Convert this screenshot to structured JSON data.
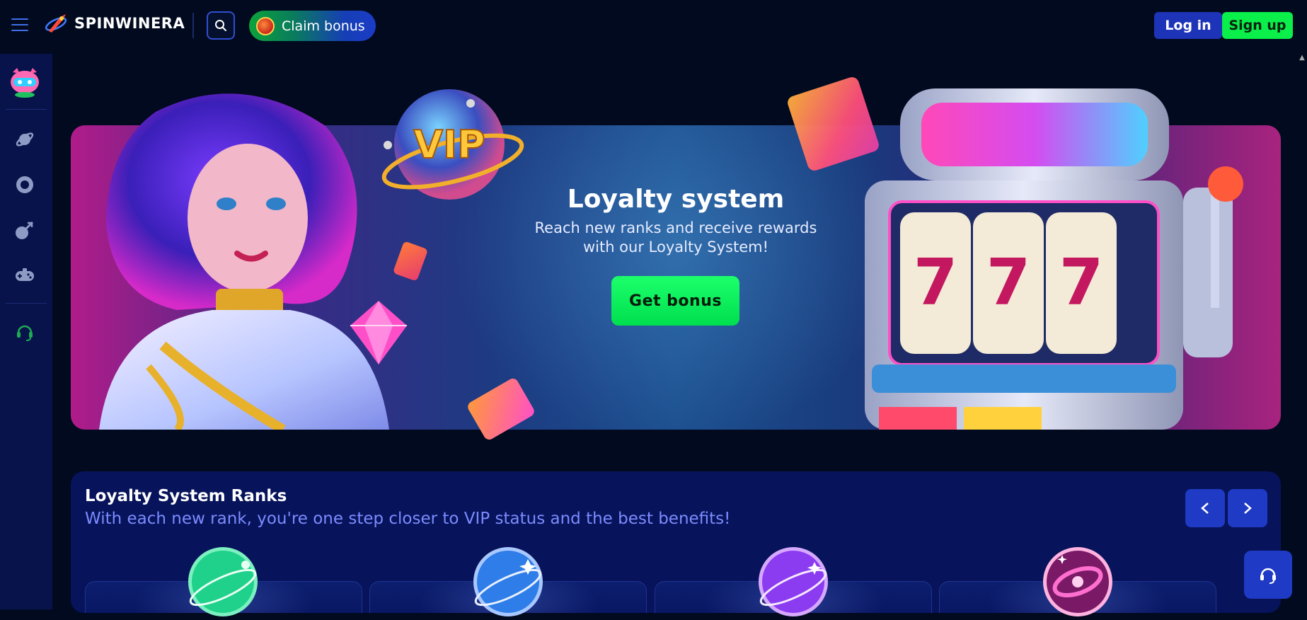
{
  "header": {
    "logo_text": "SPINWINERA",
    "claim_bonus_label": "Claim bonus",
    "login_label": "Log in",
    "signup_label": "Sign up"
  },
  "sidebar": {
    "items": [
      {
        "icon": "planet-icon"
      },
      {
        "icon": "roulette-icon"
      },
      {
        "icon": "rocket-icon"
      },
      {
        "icon": "gamepad-icon"
      },
      {
        "icon": "support-headset-icon"
      }
    ]
  },
  "hero": {
    "title": "Loyalty system",
    "subtitle": "Reach new ranks and receive rewards with our Loyalty System!",
    "button_label": "Get bonus",
    "vip_label": "VIP"
  },
  "ranks": {
    "title": "Loyalty System Ranks",
    "subtitle": "With each new rank, you're one step closer to VIP status and the best benefits!",
    "cards": [
      {
        "orb_color": "#1fd18a"
      },
      {
        "orb_color": "#2f7de8"
      },
      {
        "orb_color": "#8b3cf0"
      },
      {
        "orb_color": "#e23fa8"
      }
    ]
  },
  "colors": {
    "background": "#020a1f",
    "accent_blue": "#1f3ac4",
    "accent_green": "#0aef4a",
    "sidebar": "#07134a"
  }
}
